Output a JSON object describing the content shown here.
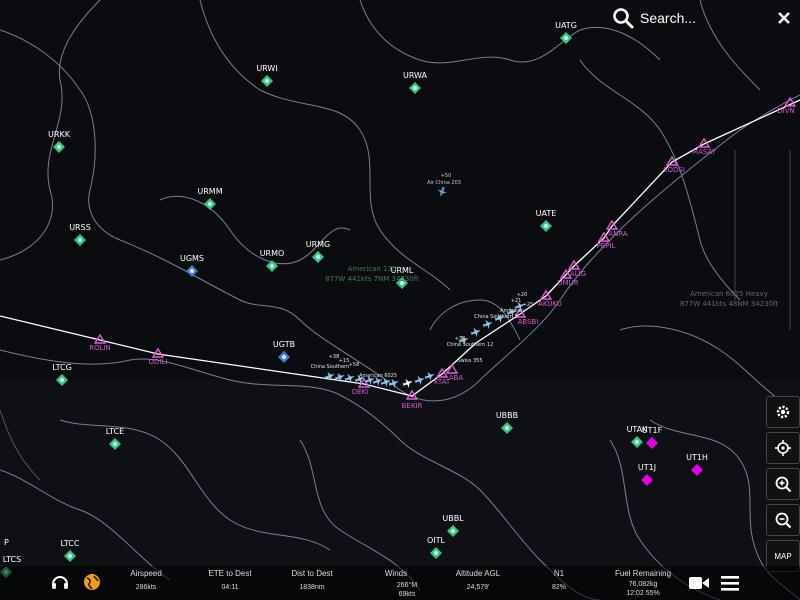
{
  "search": {
    "placeholder": "Search..."
  },
  "airports": [
    {
      "code": "UATG",
      "color": "#2ecc71"
    },
    {
      "code": "URWI",
      "color": "#2ecc71"
    },
    {
      "code": "URWA",
      "color": "#2ecc71"
    },
    {
      "code": "URKK",
      "color": "#2ecc71"
    },
    {
      "code": "URMM",
      "color": "#2ecc71"
    },
    {
      "code": "URSS",
      "color": "#2ecc71"
    },
    {
      "code": "UGMS",
      "color": "#3a7bd5"
    },
    {
      "code": "URMO",
      "color": "#2ecc71"
    },
    {
      "code": "URMG",
      "color": "#2ecc71"
    },
    {
      "code": "URML",
      "color": "#2ecc71"
    },
    {
      "code": "UATE",
      "color": "#2ecc71"
    },
    {
      "code": "UGTB",
      "color": "#3a7bd5"
    },
    {
      "code": "LTCG",
      "color": "#2ecc71"
    },
    {
      "code": "LTCE",
      "color": "#2ecc71"
    },
    {
      "code": "UBBB",
      "color": "#2ecc71"
    },
    {
      "code": "UBBL",
      "color": "#2ecc71"
    },
    {
      "code": "OITL",
      "color": "#2ecc71"
    },
    {
      "code": "LTCC",
      "color": "#2ecc71"
    },
    {
      "code": "LTCS",
      "color": "#2ecc71"
    },
    {
      "code": "UTAK",
      "color": "#2ecc71"
    },
    {
      "code": "UT1F",
      "color": "#e600e6"
    },
    {
      "code": "UT1J",
      "color": "#e600e6"
    },
    {
      "code": "UT1H",
      "color": "#e600e6"
    }
  ],
  "waypoints": [
    "ROLIN",
    "ODILI",
    "DEKI",
    "BEKIR",
    "KTAT",
    "ABA",
    "ABSBI",
    "AKUKU",
    "UMUR",
    "ALIG",
    "PEPIL",
    "ANRA",
    "SODSI",
    "MASAY",
    "DIVN"
  ],
  "traffic": {
    "air_china": {
      "name": "Air China 203",
      "alt": "+50"
    },
    "american_1357": {
      "line1": "American 135",
      "line2": "877W 441kts 7NM 34230ft"
    },
    "american_6025": {
      "line1": "American 6025 Heavy",
      "line2": "877W 441kts 48NM 34230ft"
    },
    "route_labels": [
      "American 6025",
      "China Southern",
      "Swiss 355",
      "China Southern 12",
      "American",
      "+20",
      "+21",
      "+30",
      "+38",
      "+15",
      "+58",
      "China Southern 1",
      "+25"
    ]
  },
  "stats": [
    {
      "label": "Airspeed",
      "value": "286kts"
    },
    {
      "label": "ETE to Dest",
      "value": "04:11"
    },
    {
      "label": "Dist to Dest",
      "value": "1838nm"
    },
    {
      "label": "Winds",
      "value": "266°M\n69kts"
    },
    {
      "label": "Altitude AGL",
      "value": "24,579'"
    },
    {
      "label": "N1",
      "value": "82%"
    },
    {
      "label": "Fuel Remaining",
      "value": "76,082kg\n12:02 55%"
    }
  ],
  "tools": {
    "map_label": "MAP"
  },
  "edge_letter": "P"
}
